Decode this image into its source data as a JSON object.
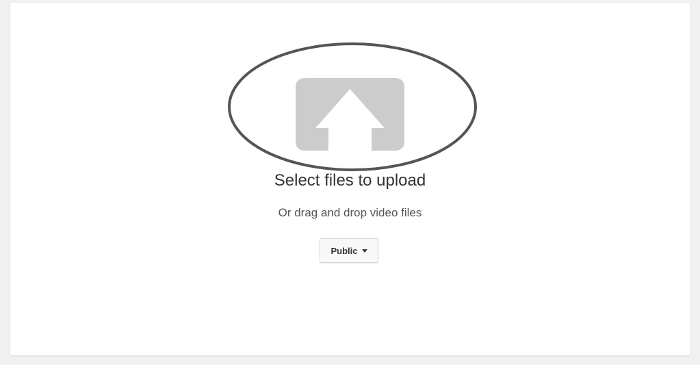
{
  "upload": {
    "title": "Select files to upload",
    "subtitle": "Or drag and drop video files",
    "icon": "upload-arrow-icon"
  },
  "privacy": {
    "selected": "Public",
    "icon": "chevron-down-icon"
  },
  "annotation": {
    "shape": "ellipse",
    "color": "#555555"
  },
  "colors": {
    "icon": "#cccccc",
    "background": "#f1f1f1",
    "card": "#ffffff"
  }
}
